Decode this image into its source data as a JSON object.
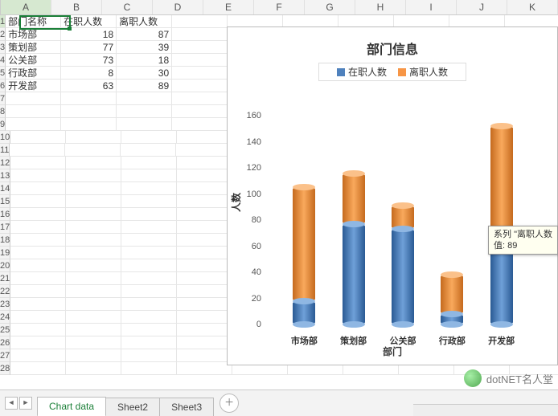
{
  "columns": [
    "A",
    "B",
    "C",
    "D",
    "E",
    "F",
    "G",
    "H",
    "I",
    "J",
    "K"
  ],
  "rowCount": 28,
  "activeCell": {
    "col": 0,
    "row": 0
  },
  "table": {
    "headers": [
      "部门名称",
      "在职人数",
      "离职人数"
    ],
    "rows": [
      {
        "dept": "市场部",
        "on": 18,
        "off": 87
      },
      {
        "dept": "策划部",
        "on": 77,
        "off": 39
      },
      {
        "dept": "公关部",
        "on": 73,
        "off": 18
      },
      {
        "dept": "行政部",
        "on": 8,
        "off": 30
      },
      {
        "dept": "开发部",
        "on": 63,
        "off": 89
      }
    ]
  },
  "chart_data": {
    "type": "bar",
    "title": "部门信息",
    "xlabel": "部门",
    "ylabel": "人数",
    "ylim": [
      0,
      160
    ],
    "ytick_step": 20,
    "categories": [
      "市场部",
      "策划部",
      "公关部",
      "行政部",
      "开发部"
    ],
    "series": [
      {
        "name": "在职人数",
        "color": "#4f81bd",
        "values": [
          18,
          77,
          73,
          8,
          63
        ]
      },
      {
        "name": "离职人数",
        "color": "#f79646",
        "values": [
          87,
          39,
          18,
          30,
          89
        ]
      }
    ]
  },
  "tooltip": {
    "line1": "系列 \"离职人数",
    "line2": "值: 89"
  },
  "sheets": {
    "active": "Chart data",
    "list": [
      "Chart data",
      "Sheet2",
      "Sheet3"
    ]
  },
  "watermark": "dotNET名人堂"
}
